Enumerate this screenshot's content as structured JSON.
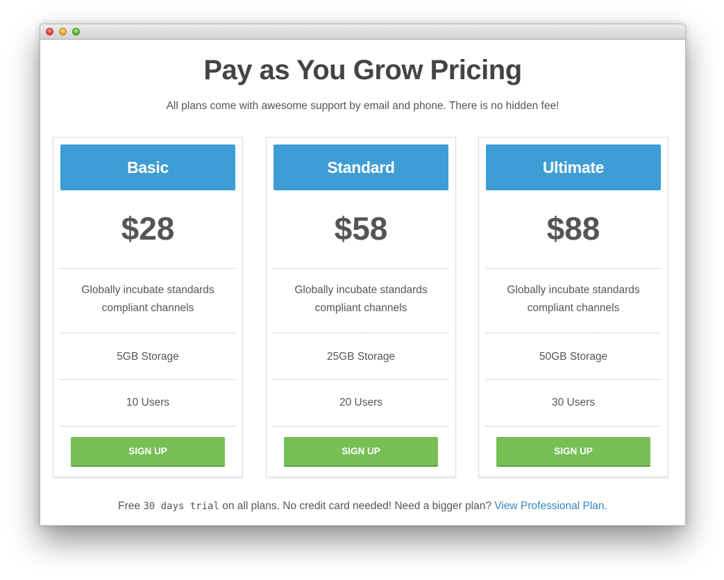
{
  "title": "Pay as You Grow Pricing",
  "subtitle": "All plans come with awesome support by email and phone. There is no hidden fee!",
  "colors": {
    "header_blue": "#3e9dd4",
    "signup_green": "#77bf55",
    "link_blue": "#3485c0",
    "text_gray": "#555555"
  },
  "plans": [
    {
      "name": "Basic",
      "price": "$28",
      "description": "Globally incubate standards compliant channels",
      "storage": "5GB Storage",
      "users": "10 Users",
      "button": "SIGN UP"
    },
    {
      "name": "Standard",
      "price": "$58",
      "description": "Globally incubate standards compliant channels",
      "storage": "25GB Storage",
      "users": "20 Users",
      "button": "SIGN UP"
    },
    {
      "name": "Ultimate",
      "price": "$88",
      "description": "Globally incubate standards compliant channels",
      "storage": "50GB Storage",
      "users": "30 Users",
      "button": "SIGN UP"
    }
  ],
  "footer": {
    "prefix": "Free ",
    "trial": "30 days trial",
    "middle": " on all plans. No credit card needed! Need a bigger plan? ",
    "link": "View Professional Plan",
    "suffix": "."
  }
}
